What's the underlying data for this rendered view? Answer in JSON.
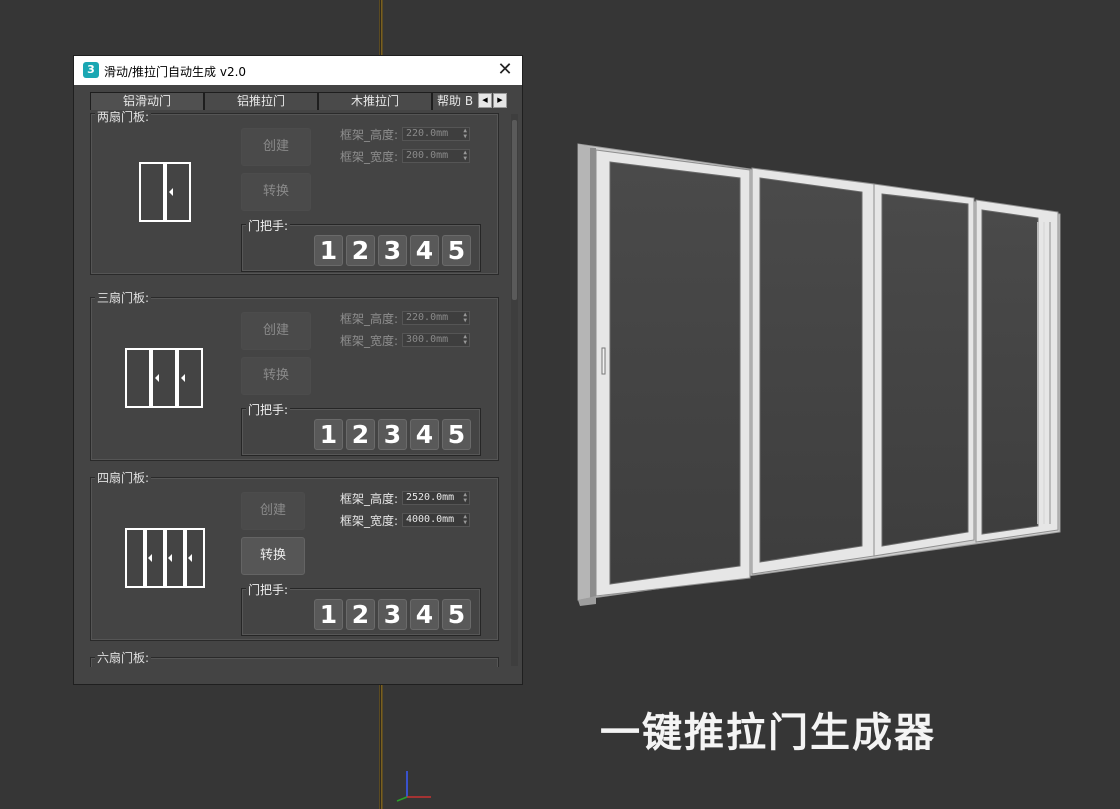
{
  "window": {
    "title": "滑动/推拉门自动生成 v2.0",
    "close_glyph": "✕",
    "app_icon_text": "3"
  },
  "tabs": [
    {
      "label": "铝滑动门"
    },
    {
      "label": "铝推拉门"
    },
    {
      "label": "木推拉门"
    },
    {
      "label": "帮助  B"
    }
  ],
  "tab_scroll": {
    "left": "◀",
    "right": "▶"
  },
  "groups": [
    {
      "label": "两扇门板:",
      "create_label": "创建",
      "convert_label": "转换",
      "height_label": "框架_高度:",
      "height_value": "220.0mm",
      "width_label": "框架_宽度:",
      "width_value": "200.0mm",
      "handle_label": "门把手:",
      "handle_buttons": [
        "1",
        "2",
        "3",
        "4",
        "5"
      ]
    },
    {
      "label": "三扇门板:",
      "create_label": "创建",
      "convert_label": "转换",
      "height_label": "框架_高度:",
      "height_value": "220.0mm",
      "width_label": "框架_宽度:",
      "width_value": "300.0mm",
      "handle_label": "门把手:",
      "handle_buttons": [
        "1",
        "2",
        "3",
        "4",
        "5"
      ]
    },
    {
      "label": "四扇门板:",
      "create_label": "创建",
      "convert_label": "转换",
      "height_label": "框架_高度:",
      "height_value": "2520.0mm",
      "width_label": "框架_宽度:",
      "width_value": "4000.0mm",
      "handle_label": "门把手:",
      "handle_buttons": [
        "1",
        "2",
        "3",
        "4",
        "5"
      ]
    },
    {
      "label": "六扇门板:"
    }
  ],
  "slogan": "一键推拉门生成器",
  "colors": {
    "viewport_bg": "#363636",
    "panel_bg": "#444444",
    "accent_line": "#7a6020"
  }
}
